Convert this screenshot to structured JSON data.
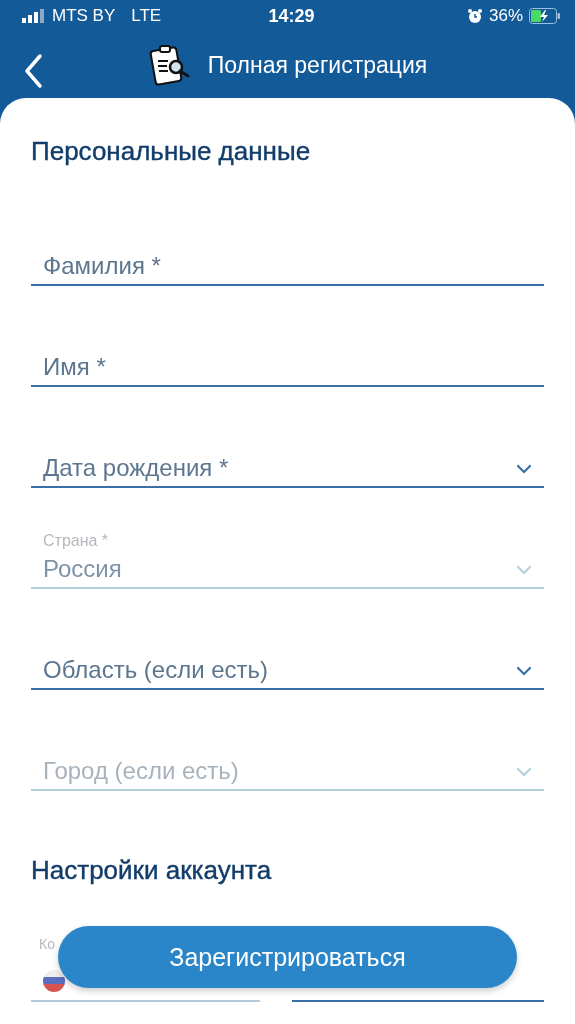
{
  "status_bar": {
    "carrier": "MTS BY",
    "network": "LTE",
    "time": "14:29",
    "battery": "36%"
  },
  "header": {
    "title": "Полная регистрация"
  },
  "sections": [
    {
      "title": "Персональные данные",
      "fields": [
        {
          "kind": "text",
          "placeholder": "Фамилия *",
          "disabled": false
        },
        {
          "kind": "text",
          "placeholder": "Имя *",
          "disabled": false
        },
        {
          "kind": "select",
          "placeholder": "Дата рождения *",
          "disabled": false
        },
        {
          "kind": "select",
          "label": "Страна *",
          "value": "Россия",
          "disabled": true
        },
        {
          "kind": "select",
          "placeholder": "Область (если есть)",
          "disabled": false
        },
        {
          "kind": "select",
          "placeholder": "Город (если есть)",
          "disabled": true
        }
      ]
    },
    {
      "title": "Настройки аккаунта",
      "phone": {
        "code_label": "Ко"
      }
    }
  ],
  "submit_button": "Зарегистрироваться"
}
